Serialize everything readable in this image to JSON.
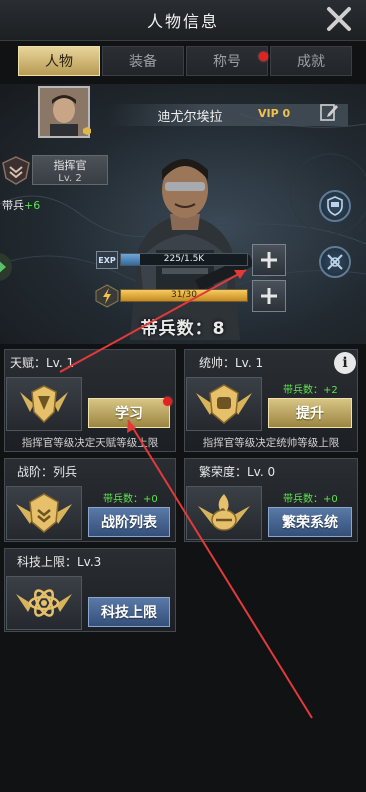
{
  "header": {
    "title": "人物信息"
  },
  "tabs": [
    {
      "label": "人物",
      "active": true
    },
    {
      "label": "装备",
      "active": false
    },
    {
      "label": "称号",
      "active": false,
      "notification": true
    },
    {
      "label": "成就",
      "active": false
    }
  ],
  "profile": {
    "name": "迪尤尔埃拉",
    "vip": "VIP 0",
    "rank_title": "指挥官",
    "rank_level": "Lv. 2",
    "troops_label": "带兵",
    "troops_value": "+6"
  },
  "exp": {
    "label": "EXP",
    "text": "225/1.5K",
    "fraction": 0.15
  },
  "energy": {
    "text": "31/30",
    "fraction": 1.0
  },
  "troop_total": "带兵数：8",
  "cards": {
    "talent": {
      "title": "天赋：Lv. 1",
      "button": "学习",
      "desc": "指挥官等级决定天赋等级上限",
      "notification": true
    },
    "command": {
      "title": "统帅：Lv. 1",
      "bonus": "带兵数：+2",
      "button": "提升",
      "desc": "指挥官等级决定统帅等级上限"
    },
    "rank": {
      "title": "战阶：列兵",
      "bonus": "带兵数：+0",
      "button": "战阶列表"
    },
    "prosperity": {
      "title": "繁荣度：Lv. 0",
      "bonus": "带兵数：+0",
      "button": "繁荣系统"
    },
    "tech": {
      "title": "科技上限：Lv.3",
      "button": "科技上限"
    }
  },
  "colors": {
    "gold": "#d8c583",
    "blue_button": "#4a6892",
    "bonus_green": "#5ee34f",
    "notification_red": "#e02222"
  }
}
